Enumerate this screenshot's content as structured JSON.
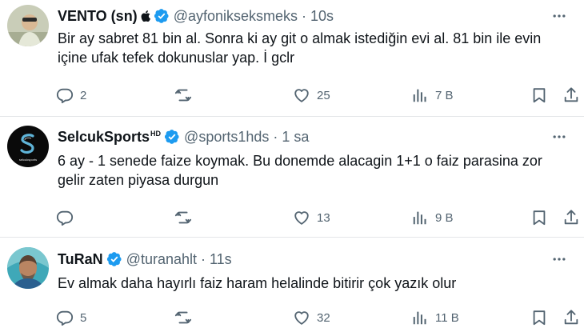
{
  "tweets": [
    {
      "name": "VENTO (sn)",
      "handle": "@ayfonikseksmeks",
      "time": "10s",
      "text": "Bir ay sabret 81 bin al. Sonra ki ay git o almak istediğin evi al. 81 bin ile evin içine ufak tefek dokunuslar yap. İ gclr",
      "replies": "2",
      "retweets": "",
      "likes": "25",
      "views": "7 B"
    },
    {
      "name": "SelcukSports",
      "name_suffix": "HD",
      "handle": "@sports1hds",
      "time": "1 sa",
      "text": "6 ay - 1 senede faize koymak. Bu donemde alacagin 1+1 o faiz parasina zor gelir zaten piyasa durgun",
      "replies": "",
      "retweets": "",
      "likes": "13",
      "views": "9 B",
      "avatar_caption": "selcuksports"
    },
    {
      "name": "TuRaN",
      "handle": "@turanahlt",
      "time": "11s",
      "text": "Ev almak daha hayırlı faiz haram helalinde bitirir çok yazık olur",
      "replies": "5",
      "retweets": "",
      "likes": "32",
      "views": "11 B"
    }
  ],
  "separator": "·",
  "colors": {
    "verified": "#1d9bf0",
    "secondary_text": "#536471",
    "primary_text": "#0f1419",
    "divider": "#e3e6e8"
  },
  "icons": [
    "verified-badge-icon",
    "apple-icon",
    "more-icon",
    "reply-icon",
    "retweet-icon",
    "like-icon",
    "views-icon",
    "bookmark-icon",
    "share-icon"
  ]
}
